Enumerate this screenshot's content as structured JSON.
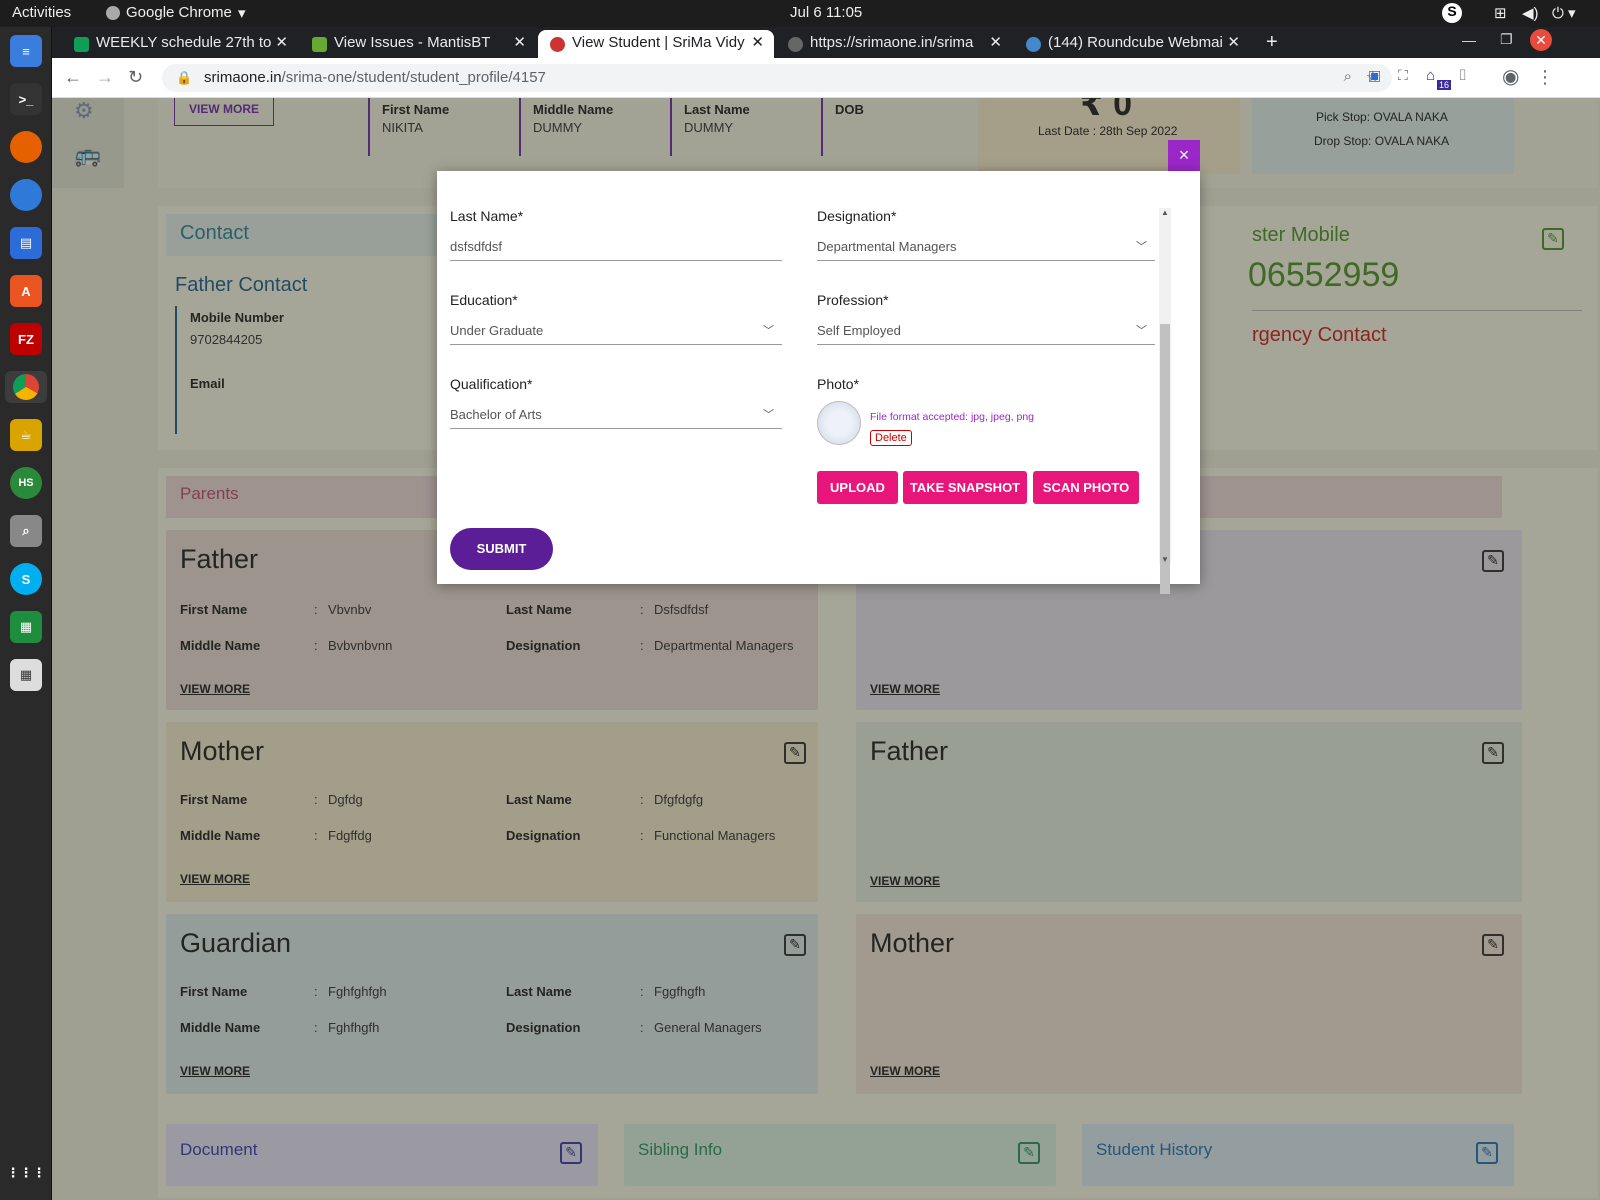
{
  "os": {
    "activities": "Activities",
    "app_menu": "Google Chrome",
    "clock": "Jul 6  11:05"
  },
  "browser": {
    "tabs": [
      {
        "title": "WEEKLY schedule 27th to",
        "active": false,
        "color": "#0f9d58"
      },
      {
        "title": "View Issues - MantisBT",
        "active": false,
        "color": "#6a3"
      },
      {
        "title": "View Student | SriMa Vidy",
        "active": true,
        "color": "#c33"
      },
      {
        "title": "https://srimaone.in/srima",
        "active": false,
        "color": "#888"
      },
      {
        "title": "(144) Roundcube Webmai",
        "active": false,
        "color": "#48c"
      }
    ],
    "url_domain": "srimaone.in",
    "url_path": "/srima-one/student/student_profile/4157",
    "ext_badge": "16"
  },
  "page": {
    "view_more_top": "VIEW MORE",
    "student": {
      "first_name_label": "First Name",
      "first_name": "NIKITA",
      "middle_name_label": "Middle Name",
      "middle_name": "DUMMY",
      "last_name_label": "Last Name",
      "last_name": "DUMMY",
      "dob_label": "DOB"
    },
    "fee": {
      "amount_partial": "₹ 0",
      "last_date": "Last Date : 28th Sep 2022"
    },
    "transport": {
      "pick": "Pick Stop: OVALA NAKA",
      "drop": "Drop Stop: OVALA NAKA"
    },
    "contact": {
      "title": "Contact",
      "father_contact": "Father Contact",
      "mobile_label": "Mobile Number",
      "mobile": "9702844205",
      "email_label": "Email",
      "master_mobile_partial": "ster Mobile",
      "master_number_partial": "06552959",
      "emergency_partial": "rgency Contact"
    },
    "parents": {
      "title": "Parents",
      "father": {
        "title": "Father",
        "fn": "Vbvnbv",
        "ln": "Dsfsdfdsf",
        "mn": "Bvbvnbvnn",
        "des": "Departmental Managers"
      },
      "mother": {
        "title": "Mother",
        "fn": "Dgfdg",
        "ln": "Dfgfdgfg",
        "mn": "Fdgffdg",
        "des": "Functional Managers"
      },
      "guardian": {
        "title": "Guardian",
        "fn": "Fghfghfgh",
        "ln": "Fggfhgfh",
        "mn": "Fghfhgfh",
        "des": "General Managers"
      },
      "labels": {
        "first": "First Name",
        "last": "Last Name",
        "middle": "Middle Name",
        "designation": "Designation",
        "colon": ":"
      },
      "view_more": "VIEW MORE",
      "right_father": "Father",
      "right_mother": "Mother"
    },
    "bottom": {
      "document": "Document",
      "sibling": "Sibling Info",
      "history": "Student History"
    }
  },
  "modal": {
    "close": "×",
    "last_name_label": "Last Name*",
    "last_name": "dsfsdfdsf",
    "designation_label": "Designation*",
    "designation": "Departmental Managers",
    "education_label": "Education*",
    "education": "Under Graduate",
    "profession_label": "Profession*",
    "profession": "Self Employed",
    "qualification_label": "Qualification*",
    "qualification": "Bachelor of Arts",
    "photo_label": "Photo*",
    "file_note": "File format accepted: jpg, jpeg, png",
    "delete": "Delete",
    "upload": "UPLOAD",
    "snapshot": "TAKE SNAPSHOT",
    "scan": "SCAN PHOTO",
    "submit": "SUBMIT"
  }
}
